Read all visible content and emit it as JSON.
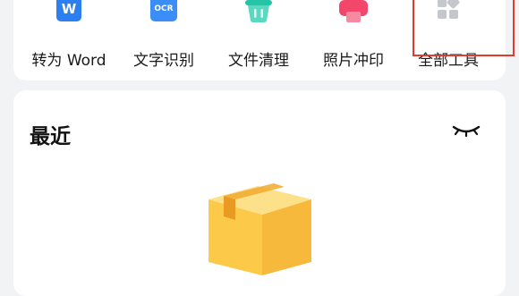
{
  "tools": [
    {
      "label": "转为 Word",
      "icon": "word-convert-icon",
      "color": "#2b7ff0",
      "glyph": "W"
    },
    {
      "label": "文字识别",
      "icon": "ocr-icon",
      "color": "#3a8ef6",
      "glyph": "OCR"
    },
    {
      "label": "文件清理",
      "icon": "file-clean-basket-icon",
      "color": "#25c3a8",
      "glyph": ""
    },
    {
      "label": "照片冲印",
      "icon": "photo-print-icon",
      "color": "#f2476b",
      "glyph": ""
    },
    {
      "label": "全部工具",
      "icon": "all-tools-grid-icon",
      "color": "#b9bcc2",
      "glyph": ""
    }
  ],
  "highlight": {
    "target": "全部工具",
    "color": "#e03c31"
  },
  "recent": {
    "title": "最近",
    "toggle_icon": "eye-closed-icon",
    "empty_illustration": "empty-box-icon"
  },
  "colors": {
    "background": "#f2f3f5",
    "card": "#ffffff",
    "box_yellow": "#fcc948"
  }
}
